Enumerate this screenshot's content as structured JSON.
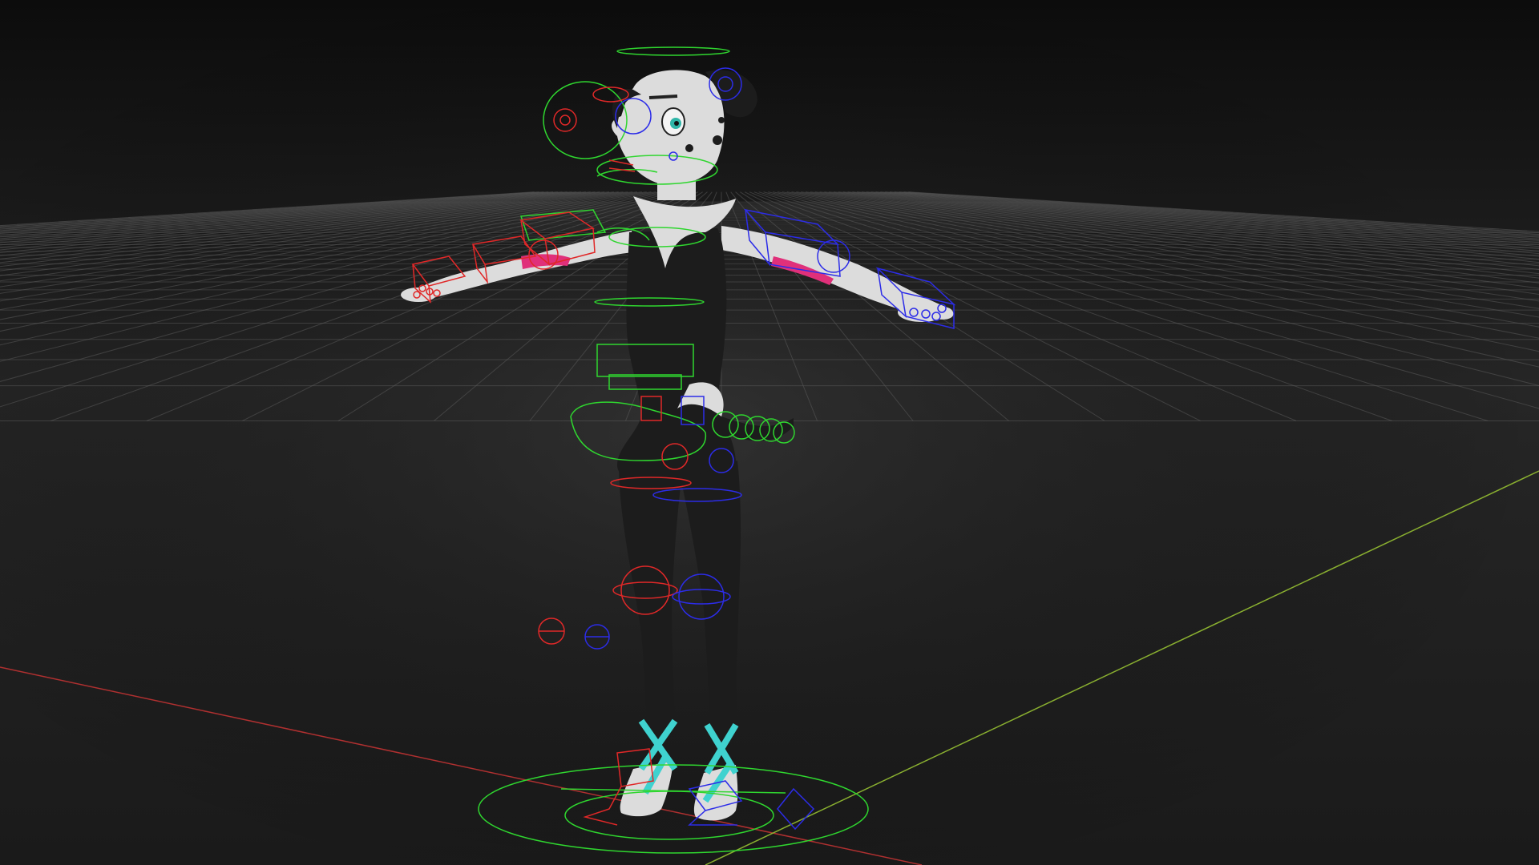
{
  "viewport": {
    "label": "",
    "colors": {
      "background_top": "#0c0c0c",
      "background_mid": "#262626",
      "background_bottom": "#1a1a1a",
      "grid": "#5a5a5a",
      "axis_x": "#b03030",
      "axis_z": "#8ab030",
      "skin": "#dcdcdc",
      "suit": "#1c1c1c",
      "ribbon": "#3fd2cf",
      "ctrl_center": "#2fd62f",
      "ctrl_left": "#e02828",
      "ctrl_right": "#2c2ce8",
      "accent_pink": "#e0307a"
    }
  },
  "character": {
    "name": "",
    "pose": "T-pose"
  },
  "rig": {
    "control_sides": [
      "center",
      "left",
      "right"
    ],
    "icons": [
      "grid-floor",
      "rig-controls",
      "character-mesh"
    ]
  }
}
